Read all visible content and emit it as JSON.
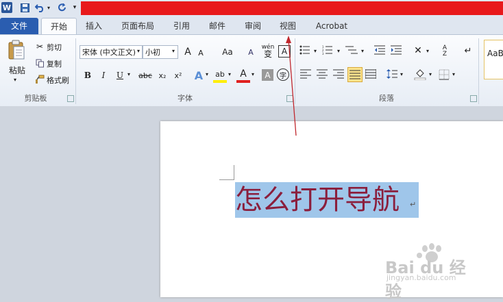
{
  "app": {
    "icon_letter": "W"
  },
  "qat": {
    "save_icon": "save-icon",
    "undo_icon": "undo-icon",
    "redo_icon": "redo-icon"
  },
  "tabs": [
    {
      "label": "文件"
    },
    {
      "label": "开始"
    },
    {
      "label": "插入"
    },
    {
      "label": "页面布局"
    },
    {
      "label": "引用"
    },
    {
      "label": "邮件"
    },
    {
      "label": "审阅"
    },
    {
      "label": "视图"
    },
    {
      "label": "Acrobat"
    }
  ],
  "clipboard": {
    "paste_label": "粘贴",
    "cut_label": "剪切",
    "copy_label": "复制",
    "format_painter_label": "格式刷",
    "group_label": "剪贴板"
  },
  "font": {
    "font_name": "宋体 (中文正文)",
    "font_size": "小初",
    "grow_label": "A",
    "shrink_label": "A",
    "case_label": "Aa",
    "clear_label": "A",
    "phonetic_label": "wén",
    "phonetic_char": "变",
    "border_char": "A",
    "bold": "B",
    "italic": "I",
    "underline": "U",
    "strike": "abc",
    "subscript": "x₂",
    "superscript": "x²",
    "text_effect": "A",
    "highlight": "ab",
    "font_color": "A",
    "char_shading": "A",
    "enclose_char": "字",
    "group_label": "字体"
  },
  "paragraph": {
    "group_label": "段落"
  },
  "styles": {
    "sample": "AaB"
  },
  "document": {
    "text": "怎么打开导航",
    "para_mark": "↵"
  },
  "watermark": {
    "brand": "Bai du 经验",
    "url": "jingyan.baidu.com"
  },
  "colors": {
    "accent_red": "#e8191b",
    "file_tab": "#2a5db0",
    "selection": "#9fc6ea",
    "text": "#8b1e3c"
  }
}
